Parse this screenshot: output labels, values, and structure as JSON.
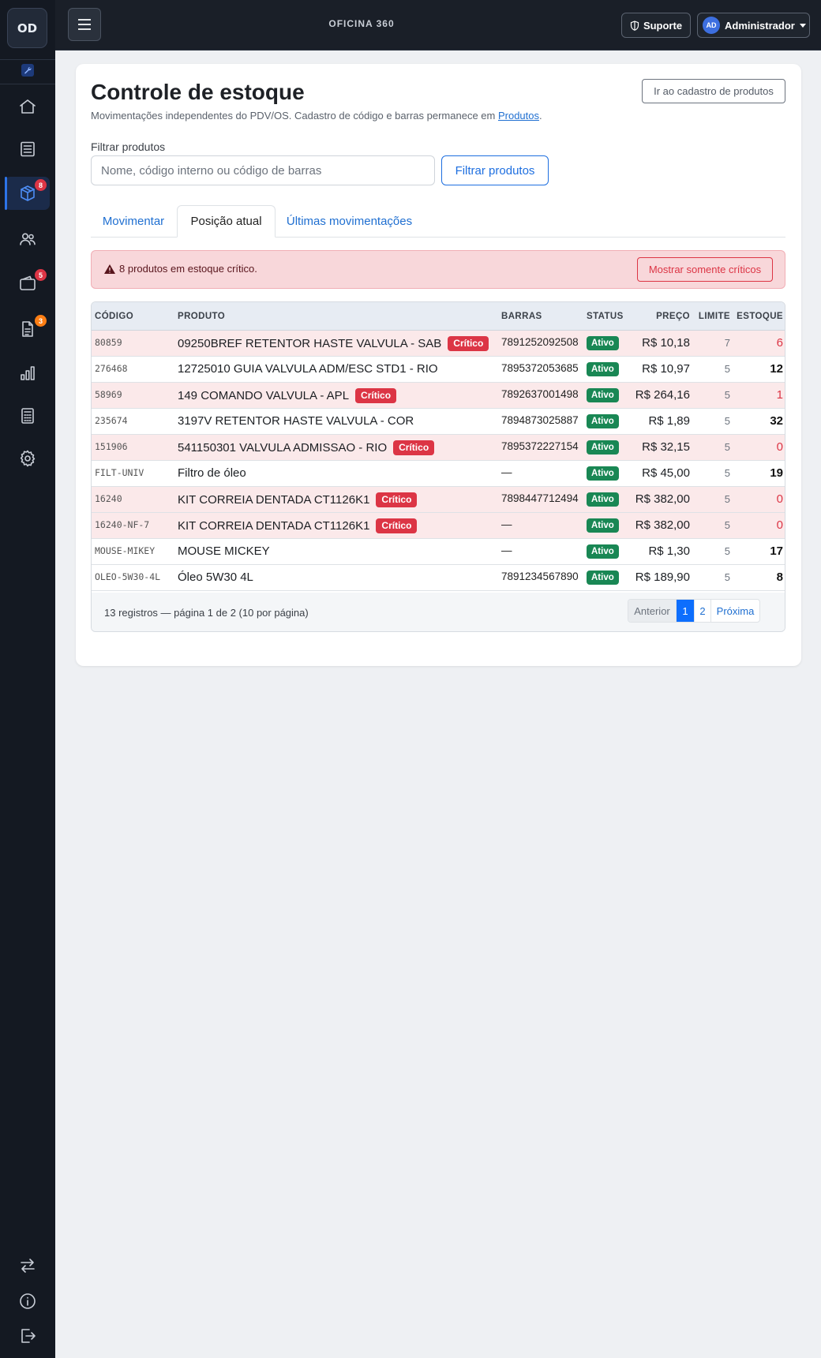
{
  "app": {
    "logo": "OD",
    "title": "OFICINA 360"
  },
  "sidebar": {
    "items": [
      {
        "name": "home-icon",
        "badge": ""
      },
      {
        "name": "list-icon",
        "badge": ""
      },
      {
        "name": "box-icon",
        "badge": "8",
        "badge_color": "#dc3545"
      },
      {
        "name": "users-icon",
        "badge": ""
      },
      {
        "name": "wallet-icon",
        "badge": "5",
        "badge_color": "#dc3545"
      },
      {
        "name": "document-icon",
        "badge": "3",
        "badge_color": "#fd7e14"
      },
      {
        "name": "bar-chart-icon",
        "badge": ""
      },
      {
        "name": "calculator-icon",
        "badge": ""
      },
      {
        "name": "gear-icon",
        "badge": ""
      }
    ],
    "bottom_items": [
      "swap-icon",
      "info-icon",
      "logout-icon"
    ]
  },
  "topbar": {
    "support_label": "Suporte",
    "avatar_initials": "AD",
    "user_label": "Administrador"
  },
  "page": {
    "title": "Controle de estoque",
    "subtitle_prefix": "Movimentações independentes do PDV/OS. Cadastro de código e barras permanece em ",
    "subtitle_link": "Produtos",
    "subtitle_suffix": ".",
    "goto_products_label": "Ir ao cadastro de produtos"
  },
  "filter": {
    "label": "Filtrar produtos",
    "placeholder": "Nome, código interno ou código de barras",
    "value": "",
    "button_label": "Filtrar produtos"
  },
  "tabs": [
    {
      "label": "Movimentar",
      "active": false
    },
    {
      "label": "Posição atual",
      "active": true
    },
    {
      "label": "Últimas movimentações",
      "active": false
    }
  ],
  "alert": {
    "text": "8 produtos em estoque crítico.",
    "button_label": "Mostrar somente críticos"
  },
  "table": {
    "headers": {
      "code": "CÓDIGO",
      "product": "PRODUTO",
      "barcode": "BARRAS",
      "status": "STATUS",
      "price": "PREÇO",
      "limit": "LIMITE",
      "stock": "ESTOQUE"
    },
    "critical_label": "Crítico",
    "rows": [
      {
        "code": "80859",
        "product": "09250BREF RETENTOR HASTE VALVULA - SAB",
        "critical": true,
        "barcode": "7891252092508",
        "status": "Ativo",
        "price": "R$ 10,18",
        "limit": "7",
        "stock": "6"
      },
      {
        "code": "276468",
        "product": "12725010 GUIA VALVULA ADM/ESC STD1 - RIO",
        "critical": false,
        "barcode": "7895372053685",
        "status": "Ativo",
        "price": "R$ 10,97",
        "limit": "5",
        "stock": "12"
      },
      {
        "code": "58969",
        "product": "149 COMANDO VALVULA - APL",
        "critical": true,
        "barcode": "7892637001498",
        "status": "Ativo",
        "price": "R$ 264,16",
        "limit": "5",
        "stock": "1"
      },
      {
        "code": "235674",
        "product": "3197V RETENTOR HASTE VALVULA - COR",
        "critical": false,
        "barcode": "7894873025887",
        "status": "Ativo",
        "price": "R$ 1,89",
        "limit": "5",
        "stock": "32"
      },
      {
        "code": "151906",
        "product": "541150301 VALVULA ADMISSAO - RIO",
        "critical": true,
        "barcode": "7895372227154",
        "status": "Ativo",
        "price": "R$ 32,15",
        "limit": "5",
        "stock": "0"
      },
      {
        "code": "FILT-UNIV",
        "product": "Filtro de óleo",
        "critical": false,
        "barcode": "—",
        "status": "Ativo",
        "price": "R$ 45,00",
        "limit": "5",
        "stock": "19"
      },
      {
        "code": "16240",
        "product": "KIT CORREIA DENTADA CT1126K1",
        "critical": true,
        "barcode": "7898447712494",
        "status": "Ativo",
        "price": "R$ 382,00",
        "limit": "5",
        "stock": "0"
      },
      {
        "code": "16240-NF-7",
        "product": "KIT CORREIA DENTADA CT1126K1",
        "critical": true,
        "barcode": "—",
        "status": "Ativo",
        "price": "R$ 382,00",
        "limit": "5",
        "stock": "0"
      },
      {
        "code": "MOUSE-MIKEY",
        "product": "MOUSE MICKEY",
        "critical": false,
        "barcode": "—",
        "status": "Ativo",
        "price": "R$ 1,30",
        "limit": "5",
        "stock": "17"
      },
      {
        "code": "OLEO-5W30-4L",
        "product": "Óleo 5W30 4L",
        "critical": false,
        "barcode": "7891234567890",
        "status": "Ativo",
        "price": "R$ 189,90",
        "limit": "5",
        "stock": "8"
      }
    ]
  },
  "footer": {
    "info": "13 registros — página 1 de 2 (10 por página)",
    "prev_label": "Anterior",
    "pages": [
      "1",
      "2"
    ],
    "current_page": "1",
    "next_label": "Próxima"
  },
  "colors": {
    "accent": "#0d6efd",
    "critical": "#dc3545",
    "active_status": "#198754",
    "sidebar_bg": "#141922"
  }
}
